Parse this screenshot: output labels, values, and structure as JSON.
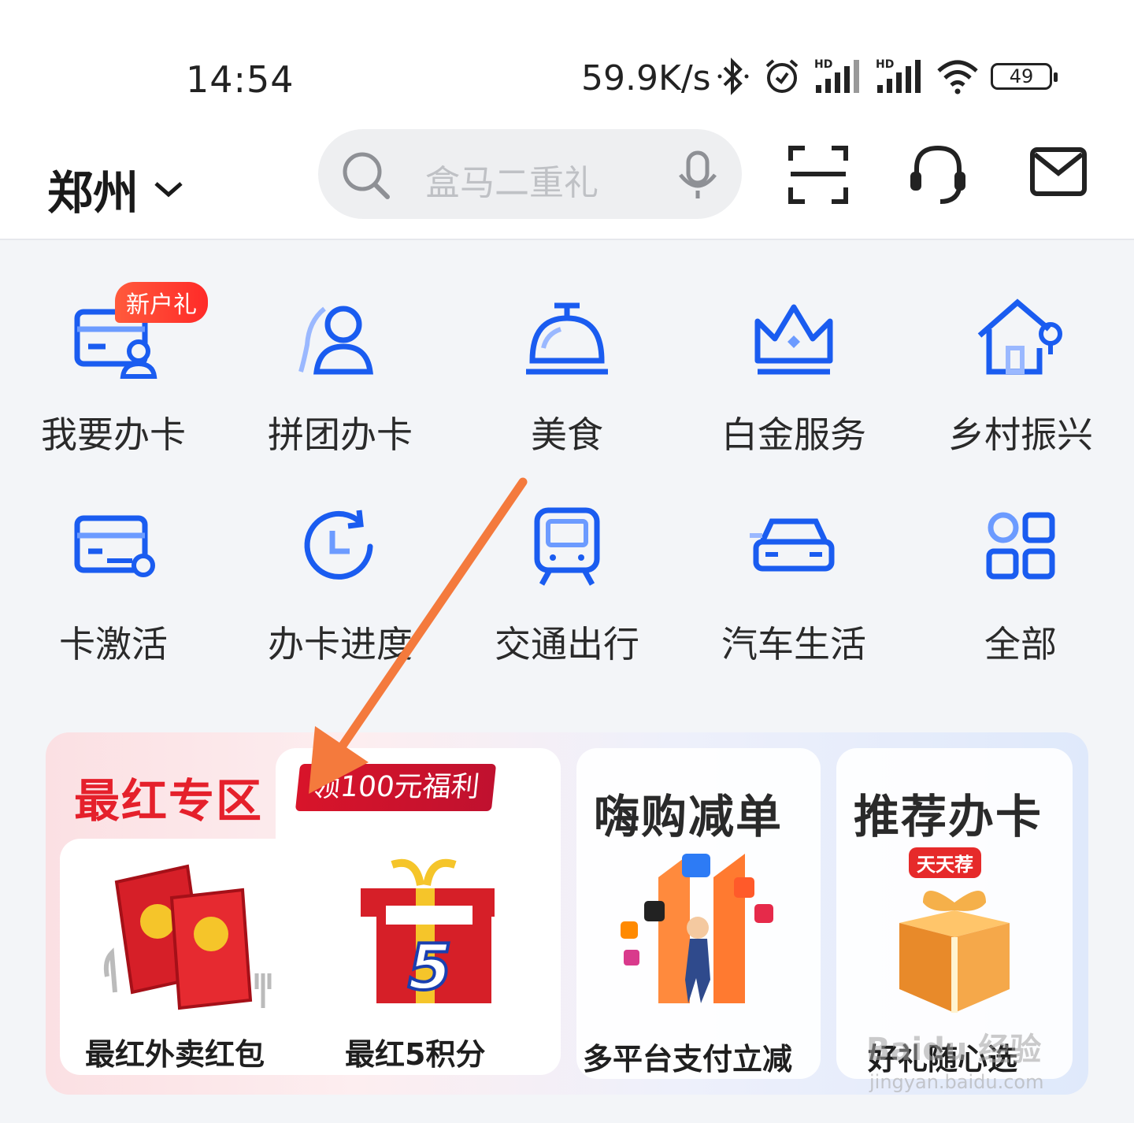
{
  "status": {
    "time": "14:54",
    "speed": "59.9K/s",
    "battery": "49",
    "icons": [
      "bluetooth-icon",
      "alarm-icon",
      "signal-hd-icon",
      "signal-hd-icon",
      "wifi-icon",
      "battery-icon"
    ]
  },
  "header": {
    "city": "郑州",
    "search_placeholder": "盒马二重礼",
    "icons": [
      "search-icon",
      "mic-icon",
      "scan-icon",
      "customer-service-icon",
      "mail-icon"
    ]
  },
  "grid": {
    "row1": [
      {
        "label": "我要办卡",
        "icon": "card-user-icon",
        "badge": "新户礼"
      },
      {
        "label": "拼团办卡",
        "icon": "group-user-icon"
      },
      {
        "label": "美食",
        "icon": "food-bell-icon"
      },
      {
        "label": "白金服务",
        "icon": "crown-icon"
      },
      {
        "label": "乡村振兴",
        "icon": "house-icon"
      }
    ],
    "row2": [
      {
        "label": "卡激活",
        "icon": "card-key-icon"
      },
      {
        "label": "办卡进度",
        "icon": "progress-icon"
      },
      {
        "label": "交通出行",
        "icon": "train-icon"
      },
      {
        "label": "汽车生活",
        "icon": "car-icon"
      },
      {
        "label": "全部",
        "icon": "grid-all-icon"
      }
    ]
  },
  "promo": {
    "zone_title": "最红专区",
    "zone_pill": "领100元福利",
    "items": [
      {
        "caption": "最红外卖红包",
        "image": "red-envelope-icon"
      },
      {
        "caption": "最红5积分",
        "image": "gift-box-5-icon"
      }
    ],
    "cards": [
      {
        "title": "嗨购减单",
        "caption": "多平台支付立减",
        "image": "double11-promo-image"
      },
      {
        "title": "推荐办卡",
        "caption": "好礼随心选",
        "tag": "天天荐",
        "image": "gift-box-icon"
      }
    ]
  },
  "watermark": {
    "line1": "Baidu 经验",
    "line2": "jingyan.baidu.com"
  },
  "colors": {
    "accent_blue": "#1a5cf0",
    "accent_red": "#e5202b",
    "arrow": "#f47a3d"
  }
}
